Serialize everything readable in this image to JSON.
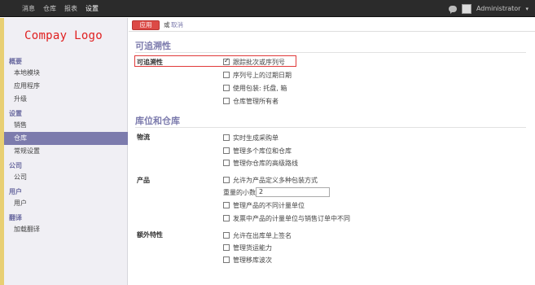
{
  "topbar": {
    "menu": [
      "消息",
      "仓库",
      "报表",
      "设置"
    ],
    "active_menu": "设置",
    "user": "Administrator",
    "caret": "▾"
  },
  "sidebar": {
    "logo": "Compay Logo",
    "sections": [
      {
        "title": "概要",
        "items": [
          "本地模块",
          "应用程序",
          "升级"
        ]
      },
      {
        "title": "设置",
        "items": [
          "销售",
          "仓库",
          "常规设置"
        ]
      },
      {
        "title": "公司",
        "items": [
          "公司"
        ]
      },
      {
        "title": "用户",
        "items": [
          "用户"
        ]
      },
      {
        "title": "翻译",
        "items": [
          "加载翻译"
        ]
      }
    ],
    "active_item": "仓库"
  },
  "actionbar": {
    "apply": "应用",
    "or": "或",
    "cancel": "取消"
  },
  "traceability": {
    "title": "可追溯性",
    "group_label": "可追溯性",
    "options": [
      {
        "label": "跟踪批次或序列号",
        "checked": true
      },
      {
        "label": "序列号上的过期日期",
        "checked": false
      },
      {
        "label": "使用包装: 托盘, 箱",
        "checked": false
      },
      {
        "label": "仓库管理所有者",
        "checked": false
      }
    ]
  },
  "locations": {
    "title": "库位和仓库",
    "logistics_label": "物流",
    "logistics_options": [
      {
        "label": "实时生成采购单",
        "checked": false
      },
      {
        "label": "管理多个库位和仓库",
        "checked": false
      },
      {
        "label": "管理你仓库的高级路线",
        "checked": false
      }
    ],
    "product_label": "产品",
    "product_option_1": "允许为产品定义多种包装方式",
    "decimal_label": "重量的小数精度",
    "decimal_value": "2",
    "product_options_rest": [
      {
        "label": "管理产品的不同计量单位",
        "checked": false
      },
      {
        "label": "发票中产品的计量单位与销售订单中不同",
        "checked": false
      }
    ],
    "extra_label": "额外特性",
    "extra_options": [
      {
        "label": "允许在出库单上签名",
        "checked": false
      },
      {
        "label": "管理货运能力",
        "checked": false
      },
      {
        "label": "管理移库波次",
        "checked": false
      }
    ]
  }
}
